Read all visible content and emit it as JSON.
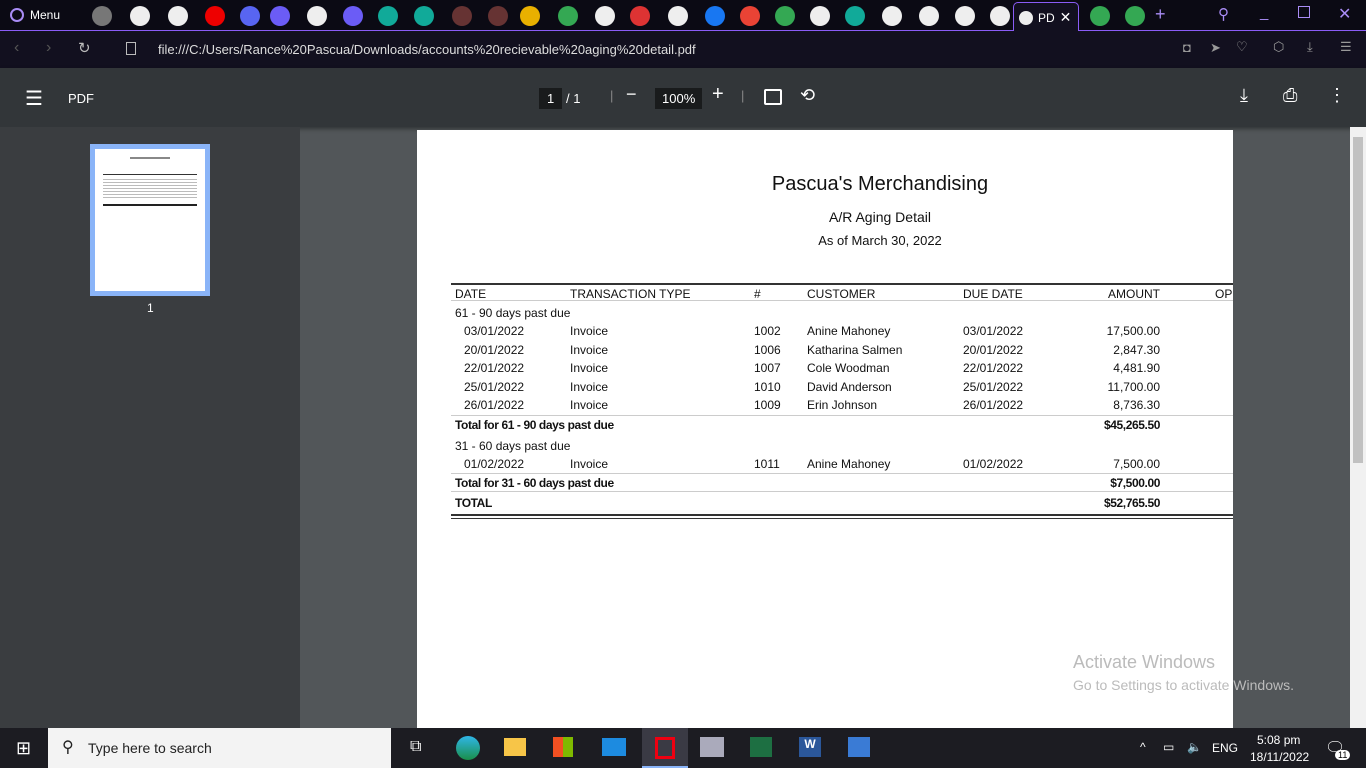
{
  "browser": {
    "menu_label": "Menu",
    "active_tab": "PD",
    "url": "file:///C:/Users/Rance%20Pascua/Downloads/accounts%20recievable%20aging%20detail.pdf"
  },
  "pdf_toolbar": {
    "title": "PDF",
    "page_current": "1",
    "page_total": "/ 1",
    "zoom": "100%"
  },
  "thumbnail": {
    "page_label": "1"
  },
  "report": {
    "company": "Pascua's Merchandising",
    "title": "A/R Aging Detail",
    "as_of": "As of March 30, 2022",
    "columns": [
      "DATE",
      "TRANSACTION TYPE",
      "#",
      "CUSTOMER",
      "DUE DATE",
      "AMOUNT",
      "OP"
    ],
    "groups": [
      {
        "label": "61 - 90 days past due",
        "rows": [
          [
            "03/01/2022",
            "Invoice",
            "1002",
            "Anine Mahoney",
            "03/01/2022",
            "17,500.00"
          ],
          [
            "20/01/2022",
            "Invoice",
            "1006",
            "Katharina Salmen",
            "20/01/2022",
            "2,847.30"
          ],
          [
            "22/01/2022",
            "Invoice",
            "1007",
            "Cole Woodman",
            "22/01/2022",
            "4,481.90"
          ],
          [
            "25/01/2022",
            "Invoice",
            "1010",
            "David Anderson",
            "25/01/2022",
            "11,700.00"
          ],
          [
            "26/01/2022",
            "Invoice",
            "1009",
            "Erin Johnson",
            "26/01/2022",
            "8,736.30"
          ]
        ],
        "total_label": "Total for 61 - 90 days past due",
        "total": "$45,265.50"
      },
      {
        "label": "31 - 60 days past due",
        "rows": [
          [
            "01/02/2022",
            "Invoice",
            "1011",
            "Anine Mahoney",
            "01/02/2022",
            "7,500.00"
          ]
        ],
        "total_label": "Total for 31 - 60 days past due",
        "total": "$7,500.00"
      }
    ],
    "grand_total_label": "TOTAL",
    "grand_total": "$52,765.50"
  },
  "watermark": {
    "title": "Activate Windows",
    "subtitle": "Go to Settings to activate Windows."
  },
  "taskbar": {
    "search_placeholder": "Type here to search",
    "language": "ENG",
    "time": "5:08 pm",
    "date": "18/11/2022",
    "notifications": "11"
  }
}
